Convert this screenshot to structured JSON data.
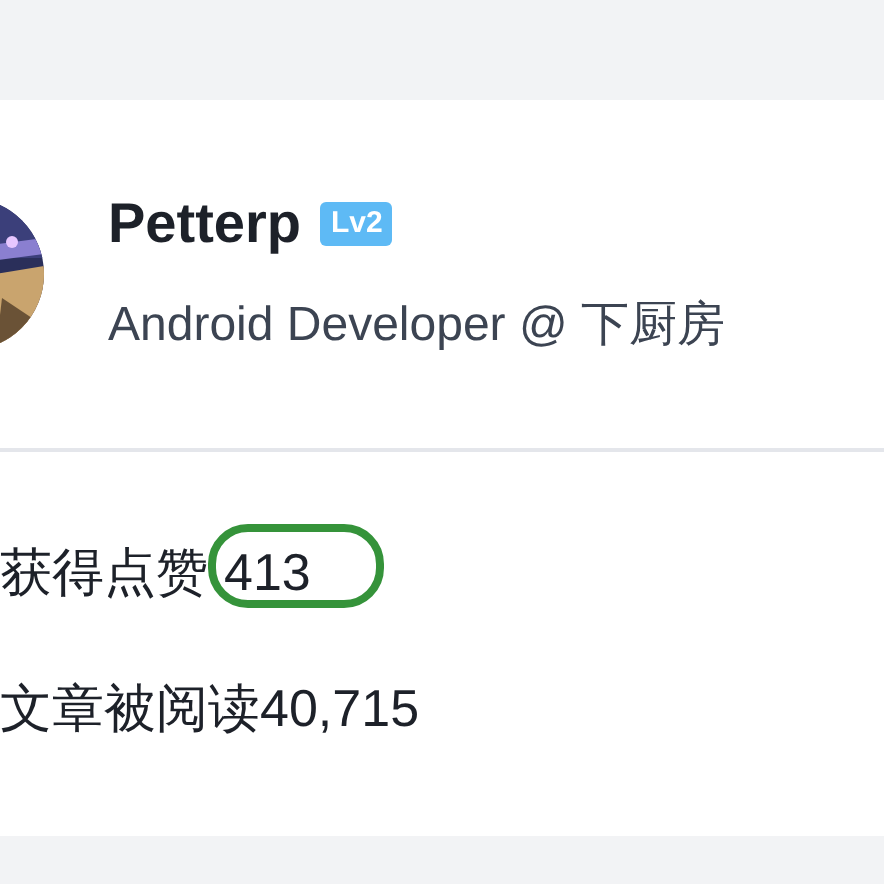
{
  "profile": {
    "name": "Petterp",
    "level_badge": "Lv2",
    "headline": "Android Developer @ 下厨房"
  },
  "stats": [
    {
      "label": "获得点赞",
      "value": "413",
      "highlighted": true
    },
    {
      "label": "文章被阅读",
      "value": "40,715",
      "highlighted": false
    }
  ]
}
